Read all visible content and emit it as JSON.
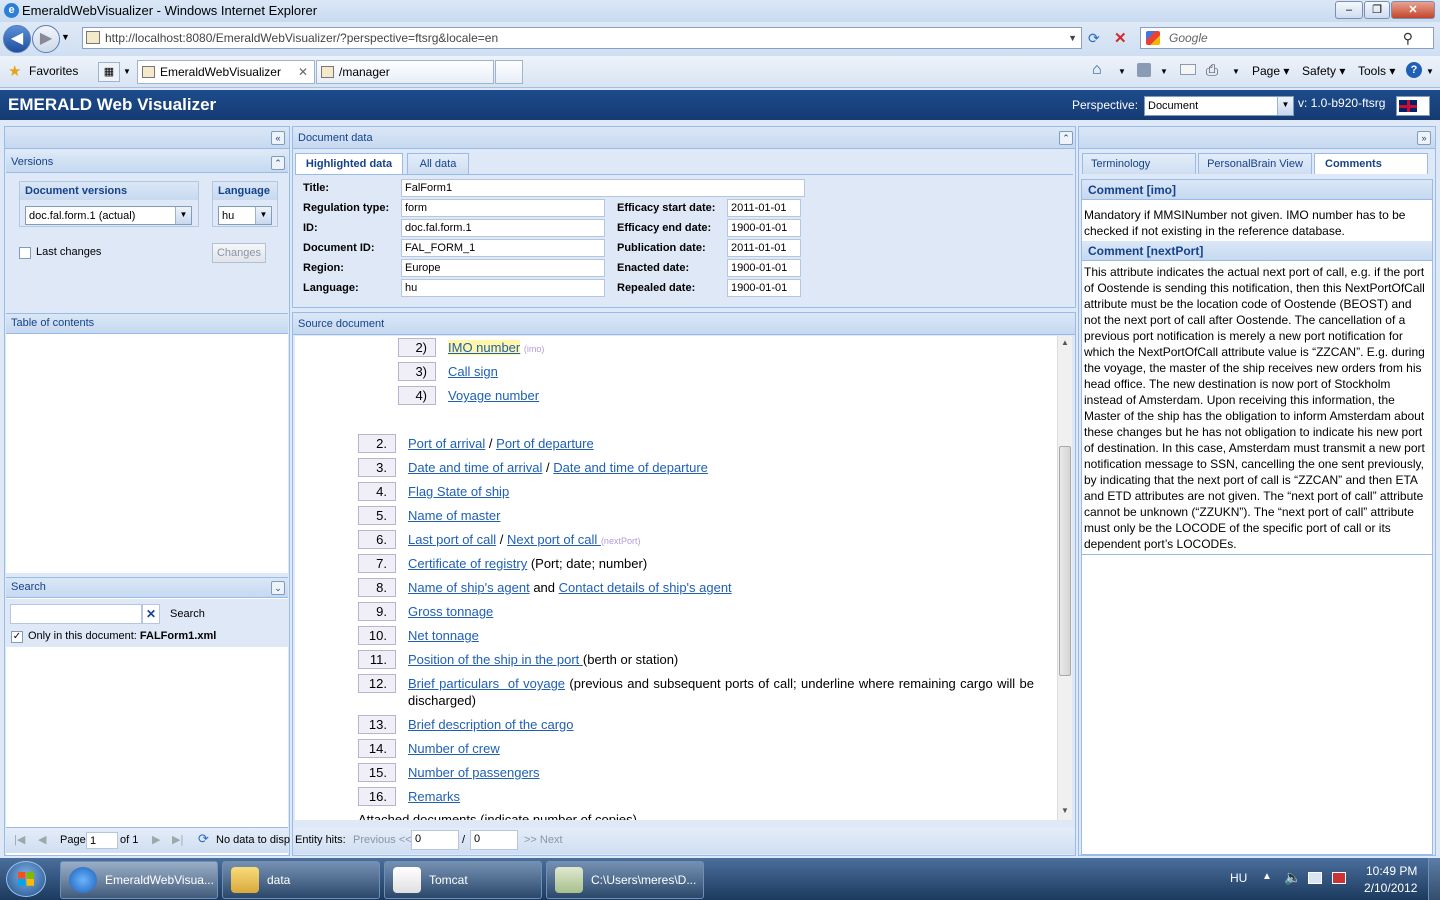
{
  "window": {
    "title": "EmeraldWebVisualizer - Windows Internet Explorer"
  },
  "browser": {
    "url": "http://localhost:8080/EmeraldWebVisualizer/?perspective=ftsrg&locale=en",
    "search_placeholder": "Google",
    "favorites_label": "Favorites",
    "tabs": [
      "EmeraldWebVisualizer",
      "/manager"
    ],
    "tools": [
      "Page",
      "Safety",
      "Tools"
    ]
  },
  "app": {
    "title": "EMERALD Web Visualizer",
    "perspective_label": "Perspective:",
    "perspective_value": "Document",
    "version": "v: 1.0-b920-ftsrg"
  },
  "left": {
    "versions_title": "Versions",
    "doc_versions_legend": "Document versions",
    "doc_version_value": "doc.fal.form.1 (actual)",
    "language_legend": "Language",
    "language_value": "hu",
    "last_changes_label": "Last changes",
    "changes_button": "Changes",
    "toc_title": "Table of contents",
    "search_title": "Search",
    "search_button": "Search",
    "only_in_doc_label": "Only in this document: ",
    "only_in_doc_file": "FALForm1.xml",
    "page_label": "Page",
    "page_value": "1",
    "page_of": "of 1",
    "no_data": "No data to disp"
  },
  "docdata": {
    "title": "Document data",
    "tabs": [
      "Highlighted data",
      "All data"
    ],
    "fields_left": [
      {
        "label": "Title:",
        "value": "FalForm1"
      },
      {
        "label": "Regulation type:",
        "value": "form"
      },
      {
        "label": "ID:",
        "value": "doc.fal.form.1"
      },
      {
        "label": "Document ID:",
        "value": "FAL_FORM_1"
      },
      {
        "label": "Region:",
        "value": "Europe"
      },
      {
        "label": "Language:",
        "value": "hu"
      }
    ],
    "fields_right": [
      {
        "label": "Efficacy start date:",
        "value": "2011-01-01"
      },
      {
        "label": "Efficacy end date:",
        "value": "1900-01-01"
      },
      {
        "label": "Publication date:",
        "value": "2011-01-01"
      },
      {
        "label": "Enacted date:",
        "value": "1900-01-01"
      },
      {
        "label": "Repealed date:",
        "value": "1900-01-01"
      }
    ]
  },
  "source": {
    "title": "Source document",
    "sub_items": [
      {
        "num": "2)",
        "text": "IMO number",
        "tag": "(imo)"
      },
      {
        "num": "3)",
        "text": "Call sign"
      },
      {
        "num": "4)",
        "text": "Voyage number"
      }
    ],
    "items": [
      {
        "num": "2.",
        "parts": [
          {
            "t": "Port of arrival",
            "l": true
          },
          {
            "t": " / ",
            "l": false
          },
          {
            "t": "Port of departure",
            "l": true
          }
        ]
      },
      {
        "num": "3.",
        "parts": [
          {
            "t": "Date and time of arrival",
            "l": true
          },
          {
            "t": " / ",
            "l": false
          },
          {
            "t": "Date and time of departure",
            "l": true
          }
        ]
      },
      {
        "num": "4.",
        "parts": [
          {
            "t": "Flag State of ship",
            "l": true
          }
        ]
      },
      {
        "num": "5.",
        "parts": [
          {
            "t": "Name of master",
            "l": true
          }
        ]
      },
      {
        "num": "6.",
        "parts": [
          {
            "t": "Last port of call",
            "l": true
          },
          {
            "t": " / ",
            "l": false
          },
          {
            "t": "Next port of call ",
            "l": true
          }
        ],
        "tag": "(nextPort)"
      },
      {
        "num": "7.",
        "parts": [
          {
            "t": "Certificate of registry",
            "l": true
          },
          {
            "t": " (Port; date; number)",
            "l": false
          }
        ]
      },
      {
        "num": "8.",
        "parts": [
          {
            "t": "Name of ship's agent",
            "l": true
          },
          {
            "t": " and ",
            "l": false
          },
          {
            "t": "Contact details of ship's agent",
            "l": true
          }
        ]
      },
      {
        "num": "9.",
        "parts": [
          {
            "t": "Gross tonnage",
            "l": true
          }
        ]
      },
      {
        "num": "10.",
        "parts": [
          {
            "t": "Net tonnage",
            "l": true
          }
        ]
      },
      {
        "num": "11.",
        "parts": [
          {
            "t": "Position of the ship in the port ",
            "l": true
          },
          {
            "t": "(berth or station)",
            "l": false
          }
        ]
      },
      {
        "num": "12.",
        "parts": [
          {
            "t": "Brief particulars  of voyage",
            "l": true
          },
          {
            "t": " (previous and subsequent ports of call; underline where remaining cargo will be discharged)",
            "l": false
          }
        ]
      },
      {
        "num": "13.",
        "parts": [
          {
            "t": "Brief description of the cargo",
            "l": true
          }
        ]
      },
      {
        "num": "14.",
        "parts": [
          {
            "t": "Number of crew",
            "l": true
          }
        ]
      },
      {
        "num": "15.",
        "parts": [
          {
            "t": "Number of passengers",
            "l": true
          }
        ]
      },
      {
        "num": "16.",
        "parts": [
          {
            "t": "Remarks",
            "l": true
          }
        ]
      }
    ],
    "cut_line": "Attached documents (indicate number of copies)",
    "entity_hits": "Entity hits:",
    "previous": "Previous <<",
    "hit_value": "0",
    "hit_of": "/",
    "hit_total": "0",
    "next": ">> Next"
  },
  "right": {
    "tabs": [
      "Terminology",
      "PersonalBrain View",
      "Comments"
    ],
    "comments": [
      {
        "title": "Comment [imo]",
        "text": "Mandatory if MMSINumber not given. IMO number has to be checked if not existing in the reference database."
      },
      {
        "title": "Comment [nextPort]",
        "text": "This attribute indicates the actual next port of call, e.g. if the port of Oostende is sending this notification, then this NextPortOfCall attribute must be the location code of Oostende (BEOST) and not the next port of call after Oostende. The cancellation of a previous port notification is merely a new port notification for which the NextPortOfCall attribute value is “ZZCAN”. E.g. during the voyage, the master of the ship receives new orders from his head office. The new destination is now port of Stockholm instead of Amsterdam. Upon receiving this information, the Master of the ship has the obligation to inform Amsterdam about these changes but he has not obligation to indicate his new port of destination. In this case, Amsterdam must transmit a new port notification message to SSN, cancelling the one sent previously, by indicating that the next port of call is “ZZCAN” and then ETA and ETD attributes are not given. The “next port of call” attribute cannot be unknown (“ZZUKN”). The “next port of call” attribute must only be the LOCODE of the specific port of call or its dependent port’s LOCODEs."
      }
    ]
  },
  "taskbar": {
    "items": [
      "EmeraldWebVisua...",
      "data",
      "Tomcat",
      "C:\\Users\\meres\\D..."
    ],
    "lang": "HU",
    "time": "10:49 PM",
    "date": "2/10/2012"
  }
}
